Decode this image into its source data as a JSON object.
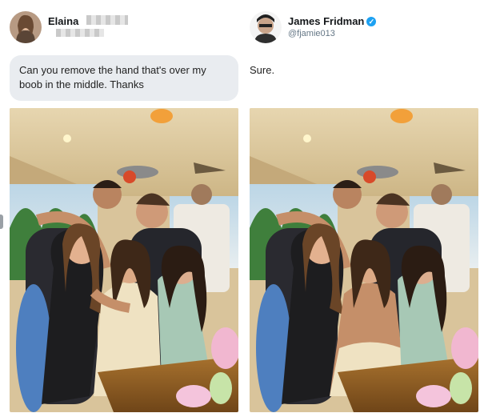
{
  "left_post": {
    "user_name": "Elaina",
    "message": "Can you remove the hand that's over my boob in the middle. Thanks"
  },
  "right_post": {
    "user_name": "James Fridman",
    "handle": "@fjamie013",
    "message": "Sure.",
    "verified_icon": "verified-check-icon"
  },
  "colors": {
    "bubble": "#e9ecf0",
    "verified": "#1da1f2",
    "handle_text": "#657786"
  }
}
